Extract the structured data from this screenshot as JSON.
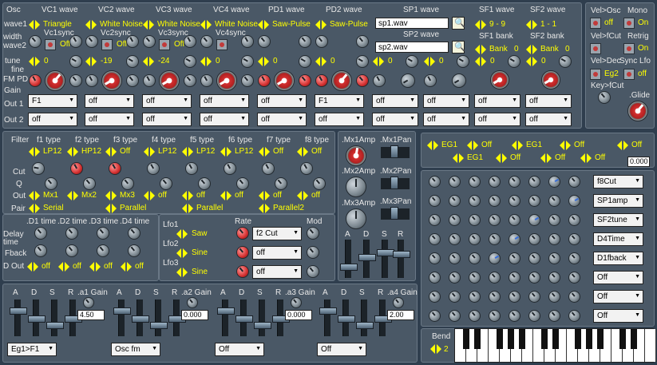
{
  "osc": {
    "labels": {
      "osc": "Osc",
      "wave1": "wave1",
      "width": "width",
      "wave2": "wave2",
      "tune": "tune",
      "fine": "fine",
      "fmpd": "FM PD",
      "gain": "Gain",
      "out1": "Out 1",
      "out2": "Out 2"
    },
    "vc": [
      {
        "title": "VC1 wave",
        "wave": "Triangle",
        "sync": "Vc1sync",
        "sync_val": "Off",
        "tune": "0",
        "out1": "F1",
        "out2": "off"
      },
      {
        "title": "VC2 wave",
        "wave": "White Noise",
        "sync": "Vc2sync",
        "sync_val": "Off",
        "tune": "-19",
        "out1": "off",
        "out2": "off"
      },
      {
        "title": "VC3 wave",
        "wave": "White Noise",
        "sync": "Vc3sync",
        "sync_val": "Off",
        "tune": "-24",
        "out1": "off",
        "out2": "off"
      },
      {
        "title": "VC4 wave",
        "wave": "White Noise",
        "sync": "Vc4sync",
        "sync_val": "",
        "tune": "0",
        "out1": "off",
        "out2": "off"
      }
    ],
    "pd": [
      {
        "title": "PD1 wave",
        "wave": "Saw-Pulse",
        "tune": "0",
        "out1": "off",
        "out2": "off"
      },
      {
        "title": "PD2 wave",
        "wave": "Saw-Pulse",
        "tune": "0",
        "out1": "F1",
        "out2": "off"
      }
    ],
    "sp": [
      {
        "title": "SP1 wave",
        "file": "sp1.wav",
        "tune": "0",
        "out1": "off",
        "out2": "off"
      },
      {
        "title": "SP2 wave",
        "file": "sp2.wav",
        "tune": "0",
        "out1": "off",
        "out2": "off"
      }
    ],
    "sf": [
      {
        "title": "SF1 wave",
        "range": "9 - 9",
        "bank_title": "SF1 bank",
        "bank": "Bank",
        "bank_val": "0",
        "tune": "0",
        "out1": "off",
        "out2": "off"
      },
      {
        "title": "SF2 wave",
        "range": "1 - 1",
        "bank_title": "SF2 bank",
        "bank": "Bank",
        "bank_val": "0",
        "tune": "0",
        "out1": "off",
        "out2": "off"
      }
    ]
  },
  "global": {
    "velosc": "Vel>Osc",
    "mono": "Mono",
    "velosc_val": "off",
    "mono_val": "On",
    "velfcut": "Vel>fCut",
    "retrig": "Retrig",
    "retrig_val": "On",
    "veldec": "Vel>Dec",
    "synclfo": "Sync Lfo",
    "veldec_val": "Eg2",
    "synclfo_val": "off",
    "keyfcut": "Key>fCut",
    "glide": ".Glide"
  },
  "filters": {
    "labels": {
      "filter": "Filter",
      "cut": "Cut",
      "q": "Q",
      "out": "Out",
      "pair": "Pair"
    },
    "items": [
      {
        "title": "f1 type",
        "type": "LP12",
        "out": "Mx1",
        "pair": "Serial"
      },
      {
        "title": "f2 type",
        "type": "HP12",
        "out": "Mx2",
        "pair": ""
      },
      {
        "title": "f3 type",
        "type": "Off",
        "out": "Mx3",
        "pair": "Parallel"
      },
      {
        "title": "f4 type",
        "type": "LP12",
        "out": "off",
        "pair": ""
      },
      {
        "title": "f5 type",
        "type": "LP12",
        "out": "off",
        "pair": "Parallel"
      },
      {
        "title": "f6 type",
        "type": "LP12",
        "out": "off",
        "pair": ""
      },
      {
        "title": "f7 type",
        "type": "Off",
        "out": "off",
        "pair": "Parallel2"
      },
      {
        "title": "f8 type",
        "type": "Off",
        "out": "off",
        "pair": ""
      }
    ]
  },
  "mix": {
    "mx1amp": ".Mx1Amp",
    "mx2amp": ".Mx2Amp",
    "mx3amp": ".Mx3Amp",
    "mx1pan": ".Mx1Pan",
    "mx2pan": ".Mx2Pan",
    "mx3pan": ".Mx3Pan",
    "a": "A",
    "d": "D",
    "s": "S",
    "r": "R"
  },
  "delay": {
    "d1": ".D1 time",
    "d2": ".D2 time",
    "d3": ".D3 time",
    "d4": ".D4 time",
    "delay_time": "Delay time",
    "fback": "Fback",
    "dout": "D Out",
    "outs": [
      "off",
      "off",
      "off",
      "off"
    ]
  },
  "lfo": {
    "labels": [
      "Lfo1",
      "Lfo2",
      "Lfo3"
    ],
    "waves": [
      "Saw",
      "Sine",
      "Sine"
    ],
    "rate": "Rate",
    "mod": "Mod",
    "targets": [
      "f2 Cut",
      "off",
      "off"
    ]
  },
  "eg_matrix": {
    "row1": [
      "EG1",
      "Off",
      "EG1",
      "Off"
    ],
    "row1b": "Off",
    "row2": [
      "EG1",
      "Off",
      "Off",
      "Off",
      "Off"
    ],
    "value": "0.000",
    "targets": [
      "f8Cut",
      "SP1amp",
      "SF2tune",
      "D4Time",
      "D1fback",
      "Off",
      "Off",
      "Off"
    ]
  },
  "envs": [
    {
      "gain": ".a1 Gain",
      "value": "4.50",
      "dest": "Eg1>F1"
    },
    {
      "gain": ".a2 Gain",
      "value": "0.000",
      "dest": "Osc fm"
    },
    {
      "gain": ".a3 Gain",
      "value": "0.000",
      "dest": "Off"
    },
    {
      "gain": ".a4 Gain",
      "value": "2.00",
      "dest": "Off"
    }
  ],
  "adsr": {
    "a": "A",
    "d": "D",
    "s": "S",
    "r": "R"
  },
  "bend": {
    "label": "Bend",
    "value": "2"
  }
}
